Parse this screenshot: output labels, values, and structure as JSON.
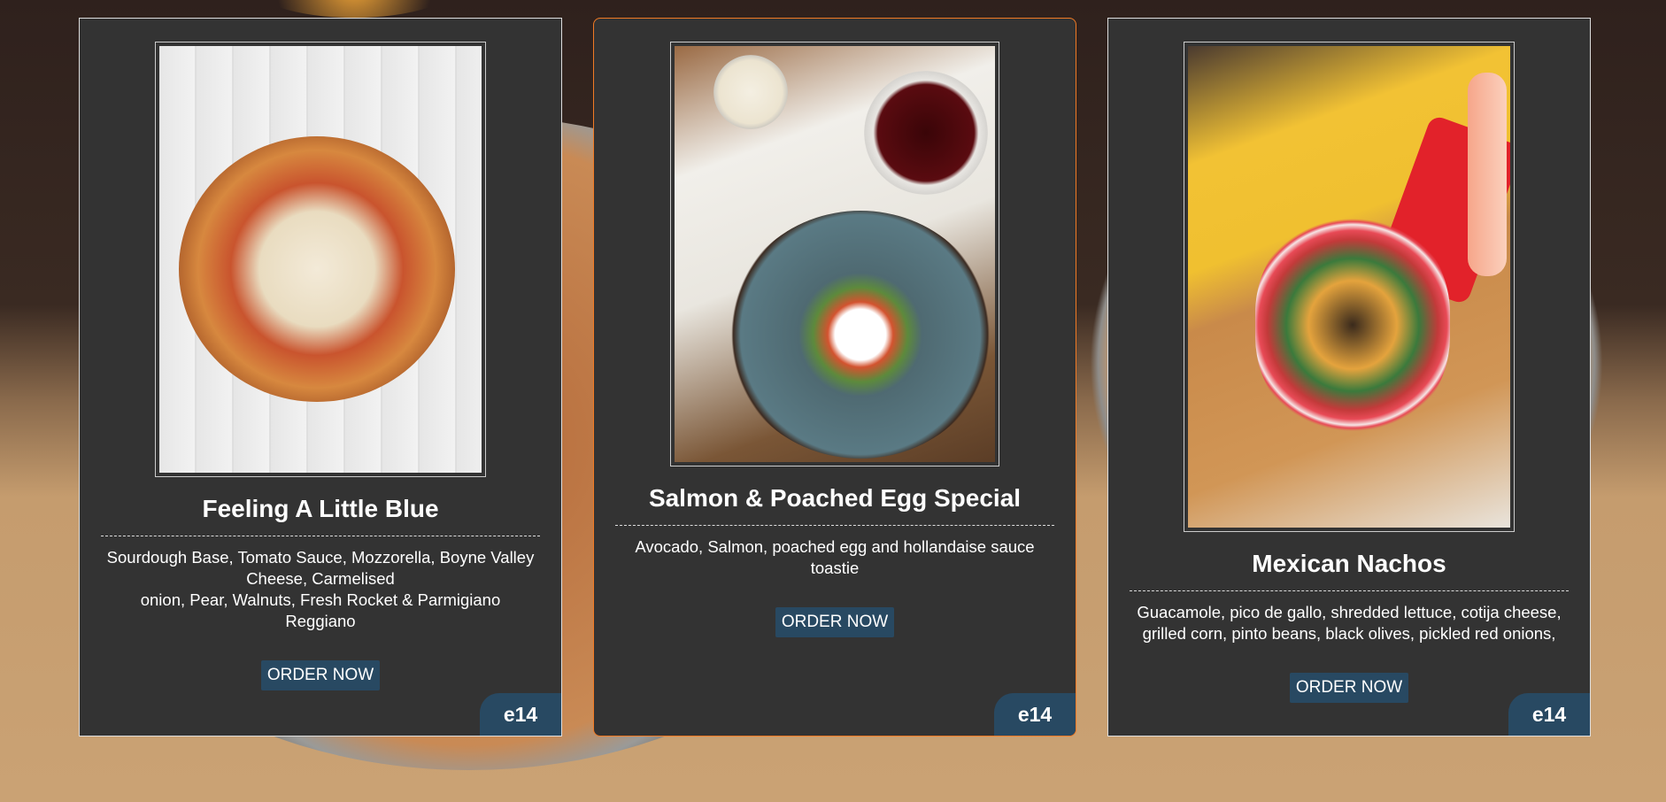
{
  "cards": [
    {
      "title": "Feeling A Little Blue",
      "description_lines": [
        "Sourdough Base, Tomato Sauce, Mozzorella, Boyne Valley Cheese, Carmelised",
        "onion, Pear, Walnuts, Fresh Rocket & Parmigiano Reggiano"
      ],
      "order_label": "ORDER NOW",
      "price": "e14",
      "image": "pizza-photo"
    },
    {
      "title": "Salmon & Poached Egg Special",
      "description": "Avocado, Salmon, poached egg and hollandaise sauce toastie",
      "order_label": "ORDER NOW",
      "price": "e14",
      "image": "salmon-egg-photo"
    },
    {
      "title": "Mexican Nachos",
      "description": "Guacamole, pico de gallo, shredded lettuce, cotija cheese, grilled corn, pinto beans, black olives, pickled red onions,",
      "order_label": "ORDER NOW",
      "price": "e14",
      "image": "nachos-photo"
    }
  ],
  "colors": {
    "card_bg": "#333333",
    "button": "#284962",
    "active_border": "#f07a24"
  }
}
